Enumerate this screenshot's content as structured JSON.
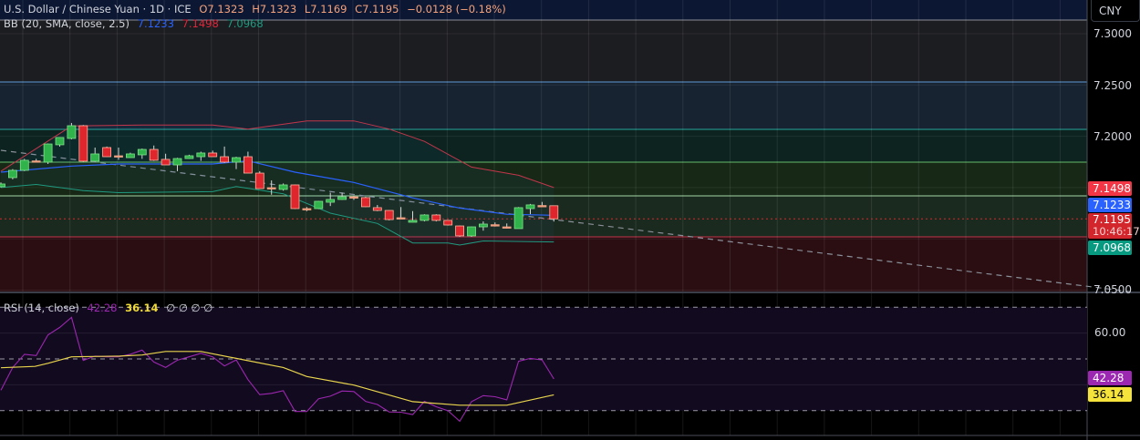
{
  "header": {
    "symbol": "U.S. Dollar / Chinese Yuan · 1D · ICE",
    "open": "O7.1323",
    "high": "H7.1323",
    "low": "L7.1169",
    "close": "C7.1195",
    "change": "−0.0128 (−0.18%)"
  },
  "bb": {
    "label": "BB (20, SMA, close, 2.5)",
    "basis": "7.1233",
    "upper": "7.1498",
    "lower": "7.0968"
  },
  "rsi": {
    "label": "RSI (14, close)",
    "value": "42.28",
    "ma": "36.14",
    "extra": "∅ ∅ ∅ ∅"
  },
  "currency": "CNY",
  "price_axis": [
    "7.3000",
    "7.2500",
    "7.2000",
    "7.0500"
  ],
  "rsi_axis": [
    "60.00"
  ],
  "badges": {
    "upper": "7.1498",
    "basis": "7.1233",
    "last": "7.1195",
    "countdown": "10:46:17",
    "lower": "7.0968",
    "rsi": "42.28",
    "rsi_ma": "36.14"
  },
  "colors": {
    "up": "#2fb34a",
    "down": "#e0262d",
    "doji": "#f0a080",
    "bb_basis": "#2962ff",
    "bb_upper": "#c2364b",
    "bb_lower": "#1f9a80",
    "rsi": "#9c27b0",
    "rsi_ma": "#e8d44d"
  },
  "chart_data": {
    "type": "candlestick",
    "price_range": [
      7.04,
      7.32
    ],
    "candles": [
      [
        7.1508,
        7.155,
        7.15,
        7.1535
      ],
      [
        7.1597,
        7.168,
        7.158,
        7.1668
      ],
      [
        7.1668,
        7.178,
        7.166,
        7.1766
      ],
      [
        7.176,
        7.178,
        7.175,
        7.1757
      ],
      [
        7.1748,
        7.193,
        7.173,
        7.1925
      ],
      [
        7.1917,
        7.199,
        7.19,
        7.1988
      ],
      [
        7.1979,
        7.213,
        7.197,
        7.2103
      ],
      [
        7.2103,
        7.211,
        7.175,
        7.1757
      ],
      [
        7.1757,
        7.189,
        7.175,
        7.1828
      ],
      [
        7.189,
        7.19,
        7.18,
        7.1801
      ],
      [
        7.181,
        7.189,
        7.177,
        7.181
      ],
      [
        7.1792,
        7.184,
        7.179,
        7.1828
      ],
      [
        7.1819,
        7.188,
        7.178,
        7.1872
      ],
      [
        7.1872,
        7.191,
        7.176,
        7.1766
      ],
      [
        7.1775,
        7.183,
        7.172,
        7.1721
      ],
      [
        7.1721,
        7.179,
        7.166,
        7.1783
      ],
      [
        7.1783,
        7.182,
        7.178,
        7.181
      ],
      [
        7.1801,
        7.185,
        7.176,
        7.1837
      ],
      [
        7.1837,
        7.186,
        7.18,
        7.1801
      ],
      [
        7.1801,
        7.19,
        7.174,
        7.1748
      ],
      [
        7.1748,
        7.18,
        7.168,
        7.1792
      ],
      [
        7.1801,
        7.185,
        7.164,
        7.1641
      ],
      [
        7.1641,
        7.166,
        7.149,
        7.149
      ],
      [
        7.1495,
        7.157,
        7.143,
        7.1499
      ],
      [
        7.1482,
        7.154,
        7.147,
        7.1526
      ],
      [
        7.1526,
        7.153,
        7.129,
        7.1295
      ],
      [
        7.1292,
        7.131,
        7.127,
        7.1295
      ],
      [
        7.1295,
        7.137,
        7.129,
        7.1366
      ],
      [
        7.1357,
        7.145,
        7.132,
        7.1384
      ],
      [
        7.1384,
        7.145,
        7.138,
        7.141
      ],
      [
        7.1408,
        7.142,
        7.138,
        7.141
      ],
      [
        7.1402,
        7.141,
        7.131,
        7.1313
      ],
      [
        7.1304,
        7.133,
        7.127,
        7.1277
      ],
      [
        7.1277,
        7.128,
        7.118,
        7.1188
      ],
      [
        7.1206,
        7.131,
        7.12,
        7.1206
      ],
      [
        7.1162,
        7.127,
        7.116,
        7.118
      ],
      [
        7.118,
        7.124,
        7.117,
        7.1233
      ],
      [
        7.1233,
        7.124,
        7.117,
        7.118
      ],
      [
        7.118,
        7.118,
        7.113,
        7.1135
      ],
      [
        7.1126,
        7.113,
        7.102,
        7.1029
      ],
      [
        7.1029,
        7.112,
        7.102,
        7.1117
      ],
      [
        7.1117,
        7.117,
        7.108,
        7.1144
      ],
      [
        7.1135,
        7.116,
        7.112,
        7.1138
      ],
      [
        7.1117,
        7.115,
        7.11,
        7.1117
      ],
      [
        7.11,
        7.131,
        7.11,
        7.1304
      ],
      [
        7.1295,
        7.134,
        7.124,
        7.1331
      ],
      [
        7.1322,
        7.136,
        7.132,
        7.1325
      ],
      [
        7.1323,
        7.1323,
        7.1169,
        7.1195
      ]
    ],
    "bb_upper": [
      [
        0,
        7.166
      ],
      [
        6,
        7.21
      ],
      [
        12,
        7.211
      ],
      [
        18,
        7.211
      ],
      [
        21,
        7.207
      ],
      [
        26,
        7.215
      ],
      [
        30,
        7.215
      ],
      [
        33,
        7.207
      ],
      [
        36,
        7.195
      ],
      [
        40,
        7.17
      ],
      [
        44,
        7.162
      ],
      [
        47,
        7.15
      ]
    ],
    "bb_basis": [
      [
        0,
        7.165
      ],
      [
        6,
        7.171
      ],
      [
        10,
        7.173
      ],
      [
        18,
        7.173
      ],
      [
        21,
        7.176
      ],
      [
        25,
        7.165
      ],
      [
        30,
        7.155
      ],
      [
        35,
        7.14
      ],
      [
        39,
        7.13
      ],
      [
        43,
        7.124
      ],
      [
        47,
        7.123
      ]
    ],
    "bb_lower": [
      [
        0,
        7.15
      ],
      [
        3,
        7.153
      ],
      [
        7,
        7.147
      ],
      [
        10,
        7.145
      ],
      [
        18,
        7.146
      ],
      [
        20,
        7.151
      ],
      [
        24,
        7.144
      ],
      [
        28,
        7.125
      ],
      [
        32,
        7.115
      ],
      [
        35,
        7.096
      ],
      [
        38,
        7.096
      ],
      [
        39,
        7.094
      ],
      [
        41,
        7.098
      ],
      [
        47,
        7.097
      ]
    ],
    "trendline": [
      [
        0,
        7.1863
      ],
      [
        96,
        7.0485
      ]
    ],
    "zones": [
      {
        "top": 7.3133,
        "bottom": 7.2529,
        "fill": "#1c1d20",
        "line": "#8a8d94"
      },
      {
        "top": 7.2529,
        "bottom": 7.2068,
        "fill": "#172331",
        "line": "#5f9bd6"
      },
      {
        "top": 7.2068,
        "bottom": 7.1748,
        "fill": "#0c231f",
        "line": "#26a69a"
      },
      {
        "top": 7.1748,
        "bottom": 7.1419,
        "fill": "#172817",
        "line": "#66bb6a"
      },
      {
        "top": 7.1419,
        "bottom": 7.102,
        "fill": "#1b2a1e",
        "line": "#a5d6a7"
      },
      {
        "top": 7.102,
        "bottom": 7.04,
        "fill": "#2a0e12",
        "line": "#c2364b"
      }
    ],
    "rsi_range": [
      15,
      77
    ],
    "rsi_levels": [
      70,
      50,
      30
    ],
    "rsi_values": [
      37.9,
      46.7,
      51.8,
      51.3,
      59.3,
      62.2,
      66.1,
      49.4,
      51.1,
      50.8,
      50.8,
      51.8,
      53.4,
      48.8,
      46.7,
      49.5,
      50.8,
      52.2,
      50.8,
      47.3,
      49.6,
      42.0,
      36.2,
      36.7,
      37.7,
      29.7,
      29.7,
      34.6,
      35.6,
      37.6,
      37.4,
      33.6,
      32.4,
      29.5,
      29.4,
      28.5,
      33.6,
      31.5,
      30.0,
      25.9,
      33.5,
      35.8,
      35.4,
      34.2,
      49.1,
      50.2,
      49.6,
      42.28
    ],
    "rsi_ma": [
      [
        0,
        46.6
      ],
      [
        2.9,
        47.1
      ],
      [
        4,
        48.3
      ],
      [
        6,
        50.8
      ],
      [
        10.1,
        51.1
      ],
      [
        12,
        51.5
      ],
      [
        14,
        52.9
      ],
      [
        17,
        52.9
      ],
      [
        20,
        50.2
      ],
      [
        24,
        46.7
      ],
      [
        26,
        43.2
      ],
      [
        30,
        39.9
      ],
      [
        35,
        33.5
      ],
      [
        39,
        32.1
      ],
      [
        43,
        32.1
      ],
      [
        47,
        36.14
      ]
    ]
  }
}
